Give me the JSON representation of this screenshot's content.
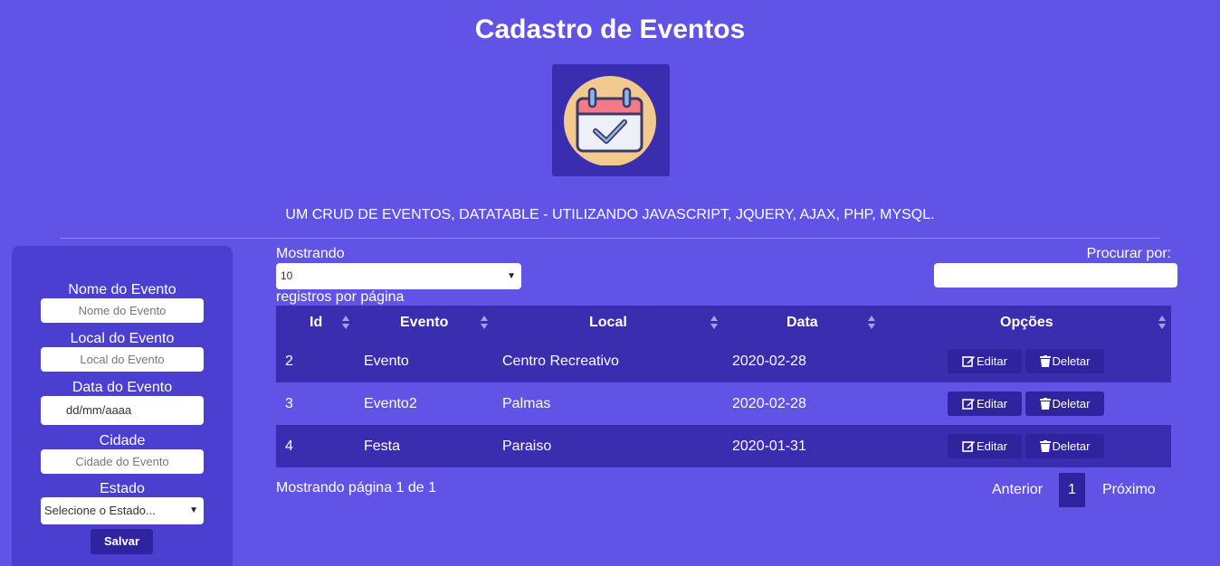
{
  "header": {
    "title": "Cadastro de Eventos",
    "subtitle": "UM CRUD DE EVENTOS, DATATABLE - UTILIZANDO JAVASCRIPT, JQUERY, AJAX, PHP, MYSQL."
  },
  "form": {
    "nome_label": "Nome do Evento",
    "nome_placeholder": "Nome do Evento",
    "local_label": "Local do Evento",
    "local_placeholder": "Local do Evento",
    "data_label": "Data do Evento",
    "data_placeholder": "dd/mm/aaaa",
    "cidade_label": "Cidade",
    "cidade_placeholder": "Cidade do Evento",
    "estado_label": "Estado",
    "estado_selected": "Selecione o Estado...",
    "save_label": "Salvar"
  },
  "table_controls": {
    "length_prefix": "Mostrando",
    "length_value": "10",
    "length_suffix": "registros por página",
    "search_label": "Procurar por:",
    "search_value": ""
  },
  "table": {
    "columns": [
      "Id",
      "Evento",
      "Local",
      "Data",
      "Opções"
    ],
    "rows": [
      {
        "id": "2",
        "evento": "Evento",
        "local": "Centro Recreativo",
        "data": "2020-02-28"
      },
      {
        "id": "3",
        "evento": "Evento2",
        "local": "Palmas",
        "data": "2020-02-28"
      },
      {
        "id": "4",
        "evento": "Festa",
        "local": "Paraiso",
        "data": "2020-01-31"
      }
    ],
    "edit_label": "Editar",
    "delete_label": "Deletar"
  },
  "footer": {
    "info": "Mostrando página 1 de 1",
    "prev": "Anterior",
    "current_page": "1",
    "next": "Próximo"
  },
  "colors": {
    "background": "#6153e6",
    "panel": "#4b3fd2",
    "header_row": "#3a2db0",
    "button": "#2f239e"
  },
  "icons": {
    "logo": "calendar-check-icon",
    "edit": "edit-icon",
    "delete": "trash-icon",
    "sort": "sort-icon"
  }
}
